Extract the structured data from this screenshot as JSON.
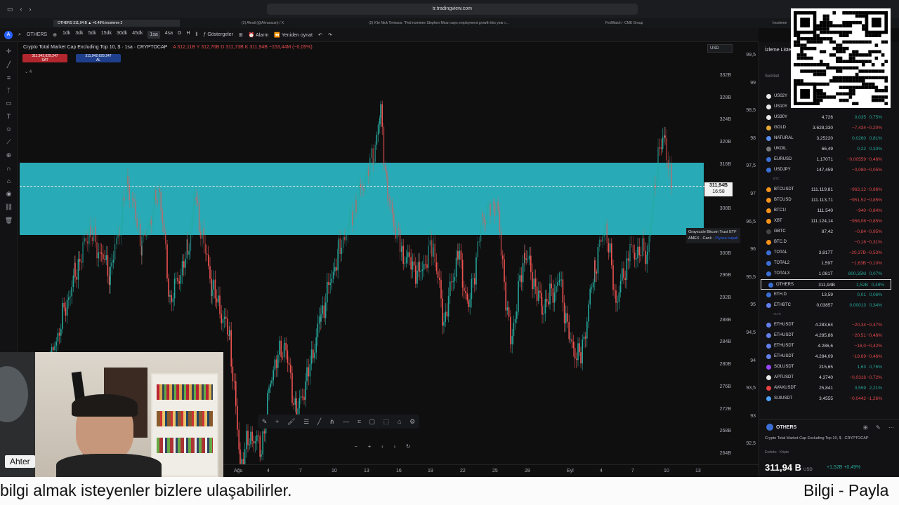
{
  "browser": {
    "url": "tr.tradingview.com",
    "tabs": [
      "OTHERS 311,94 B ▲ +0.49% inceleme 2",
      "(2) Ahrali (@Ahransum) / X",
      "(2) X'te Nick Timiraos: \"Fed nominee Stephen Miran says employment growth this year r...",
      "FedWatch - CME Group",
      "İnceleme"
    ]
  },
  "toolbar": {
    "symbol": "OTHERS",
    "intervals": [
      "1dk",
      "3dk",
      "5dk",
      "15dk",
      "30dk",
      "45dk",
      "1sa",
      "4sa",
      "G",
      "H"
    ],
    "active_interval": "1sa",
    "indicators": "Göstergeler",
    "alert": "Alarm",
    "replay": "Yeniden oynat",
    "user_initial": "A"
  },
  "chart": {
    "title": "Crypto Total Market Cap Excluding Top 10, $ · 1sa · CRYPTOCAP",
    "ohlc": "A 312,11B  Y 312,76B  D 311,73B  K 311,94B  −153,44M (−0,05%)",
    "sell_price": "311,942,629,247",
    "sell_label": "SAT",
    "buy_price": "311,942,629,247",
    "buy_label": "AL",
    "indicator_count": "4",
    "currency": "USD",
    "last_price": "311,94B",
    "countdown": "16:58",
    "tooltip_line1": "Grayscale Bitcoin Trust ETF",
    "tooltip_line2": "AMEX · Canlı",
    "tooltip_line2_link": "Piyasa kapalı",
    "x_ticks": [
      "Ağu",
      "4",
      "7",
      "10",
      "13",
      "16",
      "19",
      "22",
      "25",
      "28",
      "Eyl",
      "4",
      "7",
      "10",
      "13"
    ],
    "y_left_ticks": [
      "332B",
      "328B",
      "324B",
      "320B",
      "316B",
      "312B",
      "308B",
      "304B",
      "300B",
      "296B",
      "292B",
      "288B",
      "284B",
      "280B",
      "276B",
      "272B",
      "268B",
      "264B"
    ],
    "y_right_ticks": [
      "99,5",
      "99",
      "98,5",
      "98",
      "97,5",
      "97",
      "96,5",
      "96",
      "95,5",
      "95",
      "94,5",
      "94",
      "93,5",
      "93",
      "92,5"
    ],
    "zone_color": "#2ab9c4"
  },
  "watchlist": {
    "title": "İzleme Listesi",
    "col_symbol": "Sembol",
    "rows": [
      {
        "type": "row",
        "sym": "US02Y",
        "last": "",
        "chg": "",
        "pct": "",
        "color": "#e8e8e8"
      },
      {
        "type": "row",
        "sym": "US10Y",
        "last": "",
        "chg": "",
        "pct": "",
        "color": "#e8e8e8"
      },
      {
        "type": "row",
        "sym": "US30Y",
        "last": "4,726",
        "chg": "0,035",
        "pct": "0,75%",
        "color": "#e8e8e8"
      },
      {
        "type": "row",
        "sym": "GOLD",
        "last": "3.628,330",
        "chg": "−7,434",
        "pct": "−0,20%",
        "color": "#e8a93a"
      },
      {
        "type": "row",
        "sym": "NATURAL",
        "last": "3,25220",
        "chg": "0,0260",
        "pct": "0,81%",
        "color": "#5b8def"
      },
      {
        "type": "row",
        "sym": "UKOIL",
        "last": "66,49",
        "chg": "0,22",
        "pct": "0,33%",
        "color": "#777"
      },
      {
        "type": "row",
        "sym": "EURUSD",
        "last": "1,17071",
        "chg": "−0,00559",
        "pct": "−0,48%",
        "color": "#3b6fd6"
      },
      {
        "type": "row",
        "sym": "USDJPY",
        "last": "147,459",
        "chg": "−0,080",
        "pct": "−0,05%",
        "color": "#3b6fd6"
      },
      {
        "type": "section",
        "label": "BTC"
      },
      {
        "type": "row",
        "sym": "BTCUSDT",
        "last": "111.119,81",
        "chg": "−963,12",
        "pct": "−0,86%",
        "color": "#f7931a"
      },
      {
        "type": "row",
        "sym": "BTCUSD",
        "last": "111.113,71",
        "chg": "−951,52",
        "pct": "−0,85%",
        "color": "#f7931a"
      },
      {
        "type": "row",
        "sym": "BTC1!",
        "last": "111.540",
        "chg": "−940",
        "pct": "−0,84%",
        "color": "#f7931a"
      },
      {
        "type": "row",
        "sym": "XBT",
        "last": "111.124,14",
        "chg": "−958,06",
        "pct": "−0,85%",
        "color": "#f7931a"
      },
      {
        "type": "row",
        "sym": "GBTC",
        "last": "87,42",
        "chg": "−0,84",
        "pct": "−0,95%",
        "color": "#444"
      },
      {
        "type": "row",
        "sym": "BTC.D",
        "last": "",
        "chg": "−0,18",
        "pct": "−0,31%",
        "color": "#f7931a"
      },
      {
        "type": "row",
        "sym": "TOTAL",
        "last": "3,817T",
        "chg": "−20,37B",
        "pct": "−0,53%",
        "color": "#3b6fd6"
      },
      {
        "type": "row",
        "sym": "TOTAL2",
        "last": "1,59T",
        "chg": "−1,63B",
        "pct": "−0,10%",
        "color": "#3b6fd6"
      },
      {
        "type": "row",
        "sym": "TOTAL3",
        "last": "1,081T",
        "chg": "800,35M",
        "pct": "0,07%",
        "color": "#3b6fd6"
      },
      {
        "type": "row",
        "sym": "OTHERS",
        "last": "311,94B",
        "chg": "1,52B",
        "pct": "0,49%",
        "color": "#3b6fd6",
        "selected": true
      },
      {
        "type": "row",
        "sym": "ETH.D",
        "last": "13,59",
        "chg": "0,01",
        "pct": "0,06%",
        "color": "#3b6fd6"
      },
      {
        "type": "row",
        "sym": "ETHBTC",
        "last": "0,03857",
        "chg": "0,00013",
        "pct": "0,34%",
        "color": "#627eea"
      },
      {
        "type": "section",
        "label": "ALTS"
      },
      {
        "type": "row",
        "sym": "ETHUSDT",
        "last": "4.283,64",
        "chg": "−20,34",
        "pct": "−0,47%",
        "color": "#627eea"
      },
      {
        "type": "row",
        "sym": "ETHUSDT",
        "last": "4.285,86",
        "chg": "−20,51",
        "pct": "−0,48%",
        "color": "#627eea"
      },
      {
        "type": "row",
        "sym": "ETHUSDT",
        "last": "4.286,6",
        "chg": "−18,0",
        "pct": "−0,42%",
        "color": "#627eea"
      },
      {
        "type": "row",
        "sym": "ETHUSDT",
        "last": "4.284,09",
        "chg": "−19,69",
        "pct": "−0,46%",
        "color": "#627eea"
      },
      {
        "type": "row",
        "sym": "SOLUSDT",
        "last": "215,65",
        "chg": "1,63",
        "pct": "0,76%",
        "color": "#9945ff"
      },
      {
        "type": "row",
        "sym": "APTUSDT",
        "last": "4,3740",
        "chg": "−0,0316",
        "pct": "−0,72%",
        "color": "#e8e8e8"
      },
      {
        "type": "row",
        "sym": "AVAXUSDT",
        "last": "25,841",
        "chg": "0,559",
        "pct": "2,21%",
        "color": "#e84142"
      },
      {
        "type": "row",
        "sym": "SUIUSDT",
        "last": "3,4555",
        "chg": "−0,0442",
        "pct": "−1,26%",
        "color": "#4da2ff"
      }
    ],
    "details": {
      "sym": "OTHERS",
      "name": "Crypto Total Market Cap Excluding Top 10, $ · CRYPTOCAP",
      "sub": "Endeks · Kripto",
      "price": "311,94 B",
      "currency": "USD",
      "chg": "+1,52B +0,49%"
    }
  },
  "stream": {
    "name_tag": "Ahter",
    "ticker_left": "bilgi almak isteyenler bizlere ulaşabilirler.",
    "ticker_right": "Bilgi - Payla"
  }
}
